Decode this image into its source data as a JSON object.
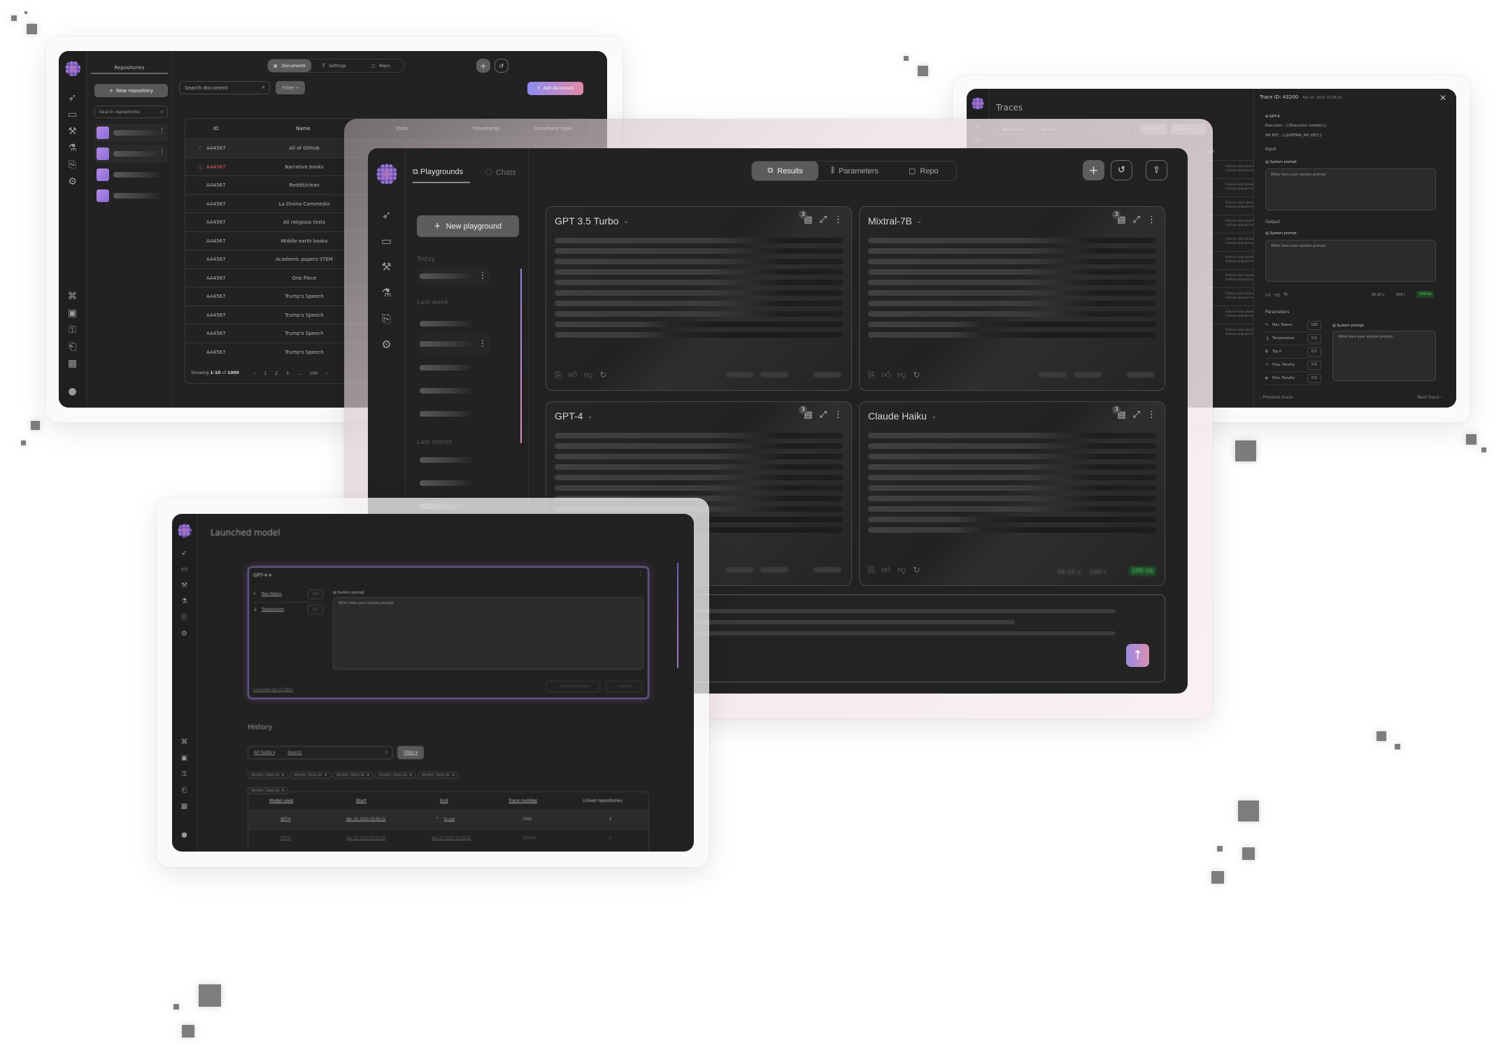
{
  "decorations": {
    "pixel_squares_color": "#7d7d7d"
  },
  "repositories_window": {
    "rail_icons": [
      "logo",
      "rocket-icon",
      "monitor-icon",
      "dumbbell-icon",
      "flask-icon",
      "code-file-icon",
      "gear-icon",
      "command-icon",
      "folder-icon",
      "key-icon",
      "clipboard-icon",
      "calendar-icon",
      "user-icon"
    ],
    "sidebar_tab": "Repositories",
    "new_button": "New repository",
    "search_placeholder": "Search repositories",
    "tabs": [
      {
        "label": "Documents",
        "active": true
      },
      {
        "label": "Settings",
        "active": false
      },
      {
        "label": "Repo",
        "active": false
      }
    ],
    "plus_label": "+",
    "search_document_placeholder": "Search document",
    "filter_label": "Filter",
    "add_document_label": "Add document",
    "columns": [
      "ID",
      "Name",
      "State",
      "Timestamp",
      "Document type"
    ],
    "rows": [
      {
        "id": "AA4567",
        "name": "All of Github",
        "status": "loading"
      },
      {
        "id": "AA4567",
        "name": "Narrative books",
        "status": "error"
      },
      {
        "id": "AA4567",
        "name": "Reddit/clean",
        "status": ""
      },
      {
        "id": "AA4567",
        "name": "La Divina Commedia",
        "status": ""
      },
      {
        "id": "AA4567",
        "name": "All religious texts",
        "status": ""
      },
      {
        "id": "AA4567",
        "name": "Middle earth books",
        "status": ""
      },
      {
        "id": "AA4567",
        "name": "Academic papers STEM",
        "status": ""
      },
      {
        "id": "AA4567",
        "name": "One Piece",
        "status": ""
      },
      {
        "id": "AA4567",
        "name": "Trump's Speech",
        "status": ""
      },
      {
        "id": "AA4567",
        "name": "Trump's Speech",
        "status": ""
      },
      {
        "id": "AA4567",
        "name": "Trump's Speech",
        "status": ""
      },
      {
        "id": "AA4567",
        "name": "Trump's Speech",
        "status": ""
      }
    ],
    "pagination": {
      "showing_prefix": "Showing",
      "range": "1-10",
      "of_word": "of",
      "total": "1000",
      "pages": [
        "1",
        "2",
        "3",
        "...",
        "100"
      ]
    }
  },
  "traces_window": {
    "title": "Traces",
    "all_fields": "All fields",
    "search_placeholder": "Search",
    "filter_label": "Filter",
    "time_filter": "Last hour",
    "column_partial": "ns/s",
    "row_snippet": "Pulvinar enim pharetra aliquam tristique aliquam malesuada",
    "detail": {
      "trace_label": "Trace ID: 43200",
      "timestamp": "Apr 23 ,2021 15:05:22",
      "model": "GPT-4",
      "execution": "Execution : {{Execution number}}",
      "api_key": "API KEY : {{$OPENAI_API_KEY}}",
      "input_heading": "Input",
      "system_prompt_label": "System prompt",
      "prompt_placeholder": "Write here your system prompt",
      "output_heading": "Output",
      "metrics": {
        "time": "00.20 s",
        "tokens": "100 t",
        "speed": "100 t/s"
      },
      "parameters_heading": "Parameters",
      "parameters": [
        {
          "label": "Max Tokens",
          "value": "100"
        },
        {
          "label": "Temperature",
          "value": "0.5"
        },
        {
          "label": "Top P.",
          "value": "0.5"
        },
        {
          "label": "Freq. Penalty",
          "value": "0.5"
        },
        {
          "label": "Pres. Penalty",
          "value": "0.5"
        }
      ],
      "previous": "Previous trace",
      "next": "Next trace"
    }
  },
  "playground_window": {
    "sidebar_tabs": [
      {
        "label": "Playgrounds",
        "active": true
      },
      {
        "label": "Chats",
        "active": false
      }
    ],
    "new_button": "New playground",
    "groups": [
      "Today",
      "Last week",
      "Last month"
    ],
    "top_tabs": [
      {
        "label": "Results",
        "active": true
      },
      {
        "label": "Parameters",
        "active": false
      },
      {
        "label": "Repo",
        "active": false
      }
    ],
    "actions": {
      "add": "+",
      "history": "history",
      "export": "export"
    },
    "cards": [
      {
        "model": "GPT 3.5 Turbo",
        "doc_count": "3"
      },
      {
        "model": "Mixtral-7B",
        "doc_count": "3"
      },
      {
        "model": "GPT-4",
        "doc_count": "3"
      },
      {
        "model": "Claude Haiku",
        "doc_count": "3",
        "metrics": {
          "time": "00.20 s",
          "tokens": "100 t",
          "speed": "100 t/s"
        }
      }
    ],
    "send_button_colors": [
      "#9b8be0",
      "#d98fb3"
    ]
  },
  "launched_window": {
    "title": "Launched model",
    "model": "GPT-4",
    "params": [
      {
        "label": "Max Tokens",
        "value": "100"
      },
      {
        "label": "Temperature",
        "value": "0.5"
      }
    ],
    "system_prompt_label": "System prompt",
    "prompt_placeholder": "Write here your system prompt",
    "launched_text": "Launched Apr 23 2021",
    "discard_label": "Discard changes",
    "launch_label": "Launch",
    "history_title": "History",
    "all_fields": "All fields",
    "search_placeholder": "Search",
    "filter_label": "Filter",
    "chips": [
      "Vendor: Open-Ai",
      "Vendor: Open-Ai",
      "Vendor: Open-Ai",
      "Vendor: Open-Ai",
      "Vendor: Open-Ai",
      "Vendor: Open-Ai"
    ],
    "columns": [
      "Model used",
      "Start",
      "End",
      "Trace number",
      "Linked repositories"
    ],
    "rows": [
      {
        "model": "GPT-4",
        "start": "Apr 23 ,2021 15:05:22",
        "end": "In use",
        "trace": "2300",
        "linked": "3"
      },
      {
        "model": "GPT-4",
        "start": "Apr 23 ,2021 15:05:22",
        "end": "Apr 23 ,2021 15:05:22",
        "trace": "103249",
        "linked": "0"
      }
    ]
  }
}
